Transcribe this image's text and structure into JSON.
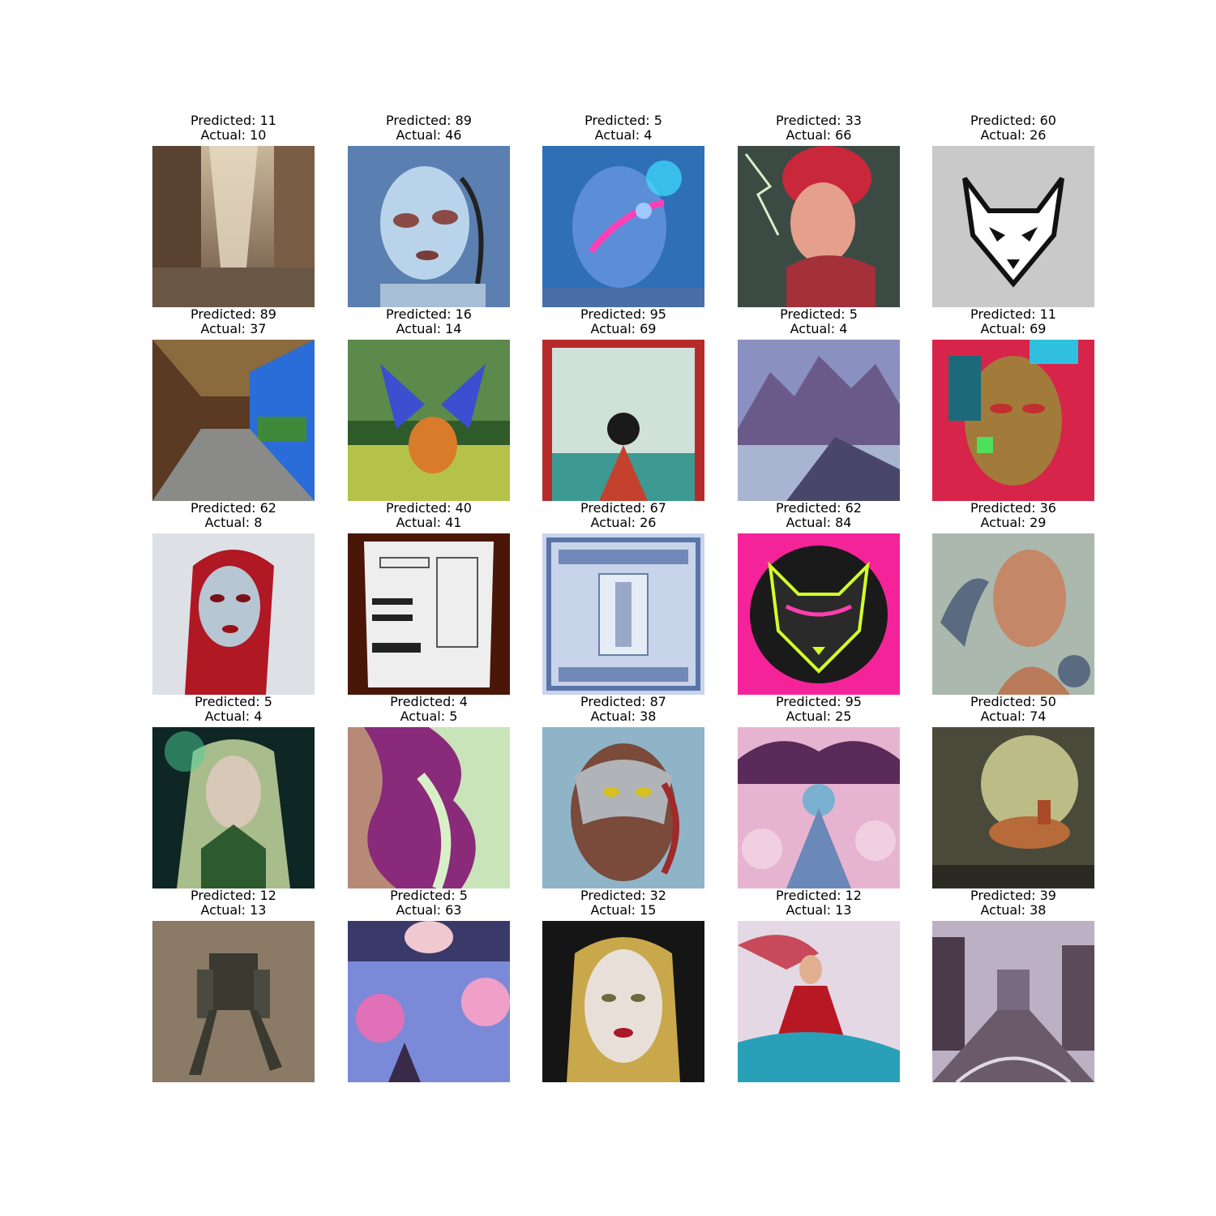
{
  "figure": {
    "rows": 5,
    "cols": 5,
    "cells": [
      {
        "predicted": "Predicted: 11",
        "actual": "Actual: 10",
        "image": "ruined-city-street"
      },
      {
        "predicted": "Predicted: 89",
        "actual": "Actual: 46",
        "image": "pale-cyborg-face"
      },
      {
        "predicted": "Predicted: 5",
        "actual": "Actual: 4",
        "image": "blue-neon-cyborg-face"
      },
      {
        "predicted": "Predicted: 33",
        "actual": "Actual: 66",
        "image": "red-hair-woman-lightning"
      },
      {
        "predicted": "Predicted: 60",
        "actual": "Actual: 26",
        "image": "fox-logo"
      },
      {
        "predicted": "Predicted: 89",
        "actual": "Actual: 37",
        "image": "tunnel-landscape-window"
      },
      {
        "predicted": "Predicted: 16",
        "actual": "Actual: 14",
        "image": "blue-dragon-forest"
      },
      {
        "predicted": "Predicted: 95",
        "actual": "Actual: 69",
        "image": "anime-poster"
      },
      {
        "predicted": "Predicted: 5",
        "actual": "Actual: 4",
        "image": "purple-mountains-lake"
      },
      {
        "predicted": "Predicted: 11",
        "actual": "Actual: 69",
        "image": "neon-cyborg-woman"
      },
      {
        "predicted": "Predicted: 62",
        "actual": "Actual: 8",
        "image": "red-hair-pale-woman"
      },
      {
        "predicted": "Predicted: 40",
        "actual": "Actual: 41",
        "image": "technical-document"
      },
      {
        "predicted": "Predicted: 67",
        "actual": "Actual: 26",
        "image": "blue-blueprint-board"
      },
      {
        "predicted": "Predicted: 62",
        "actual": "Actual: 84",
        "image": "neon-wolf-pink"
      },
      {
        "predicted": "Predicted: 36",
        "actual": "Actual: 29",
        "image": "bald-figure-robotic-arms"
      },
      {
        "predicted": "Predicted: 5",
        "actual": "Actual: 4",
        "image": "green-elf-woman"
      },
      {
        "predicted": "Predicted: 4",
        "actual": "Actual: 5",
        "image": "wavy-hair-woman-profile"
      },
      {
        "predicted": "Predicted: 87",
        "actual": "Actual: 38",
        "image": "cyborg-man-portrait"
      },
      {
        "predicted": "Predicted: 95",
        "actual": "Actual: 25",
        "image": "anime-girl-pink-clouds"
      },
      {
        "predicted": "Predicted: 50",
        "actual": "Actual: 74",
        "image": "horse-rider-fog"
      },
      {
        "predicted": "Predicted: 12",
        "actual": "Actual: 13",
        "image": "armored-robot"
      },
      {
        "predicted": "Predicted: 5",
        "actual": "Actual: 63",
        "image": "anime-pastel-sky"
      },
      {
        "predicted": "Predicted: 32",
        "actual": "Actual: 15",
        "image": "blonde-woman-portrait"
      },
      {
        "predicted": "Predicted: 12",
        "actual": "Actual: 13",
        "image": "red-dress-woman-waves"
      },
      {
        "predicted": "Predicted: 39",
        "actual": "Actual: 38",
        "image": "futuristic-city-highway"
      }
    ]
  }
}
